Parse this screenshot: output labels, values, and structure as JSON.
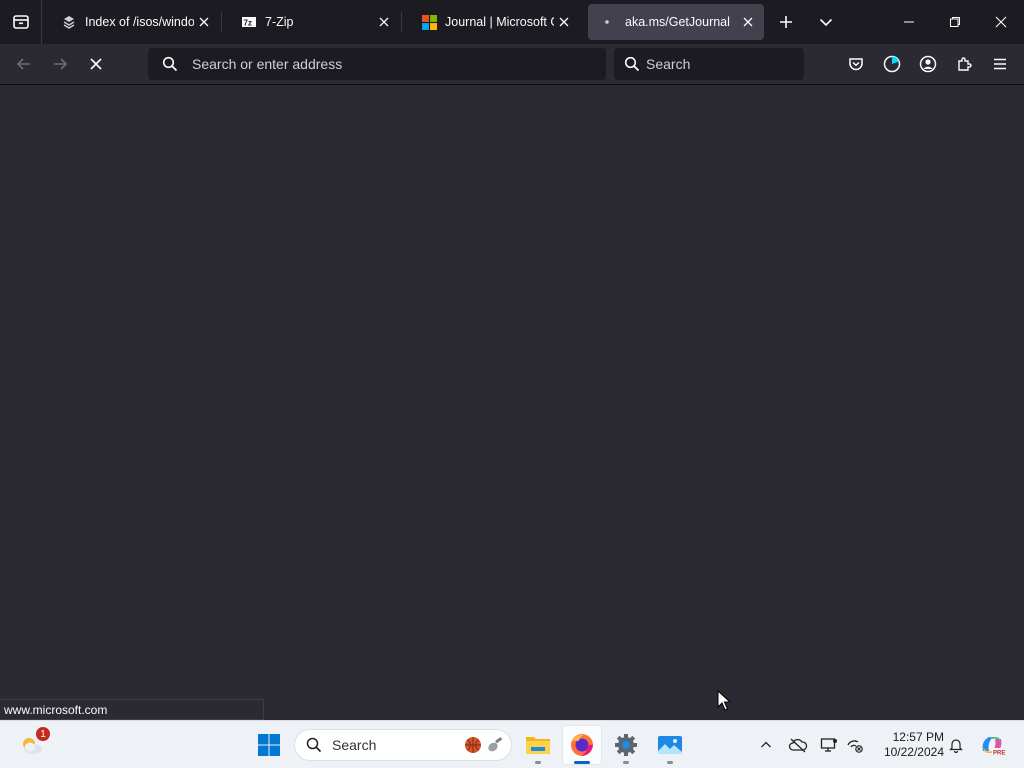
{
  "browser": {
    "tabs": [
      {
        "title": "Index of /isos/windows",
        "favicon": "page-icon",
        "active": false
      },
      {
        "title": "7-Zip",
        "favicon": "7zip-icon",
        "active": false
      },
      {
        "title": "Journal | Microsoft Garage",
        "favicon": "microsoft-logo-icon",
        "active": false
      },
      {
        "title": "aka.ms/GetJournal",
        "favicon": "loading-dot-icon",
        "active": true
      }
    ],
    "toolbar": {
      "url_placeholder": "Search or enter address",
      "search_placeholder": "Search"
    },
    "status_text": "www.microsoft.com"
  },
  "taskbar": {
    "search_placeholder": "Search",
    "widget_badge": "1",
    "clock_time": "12:57 PM",
    "clock_date": "10/22/2024",
    "pinned": [
      "file-explorer-icon",
      "firefox-icon",
      "settings-icon",
      "photos-icon"
    ]
  },
  "colors": {
    "tabstrip_bg": "#1c1b22",
    "toolbar_bg": "#2b2a33",
    "active_tab_bg": "#42414d",
    "taskbar_bg": "#eef1f6",
    "accent": "#0a64c8"
  }
}
